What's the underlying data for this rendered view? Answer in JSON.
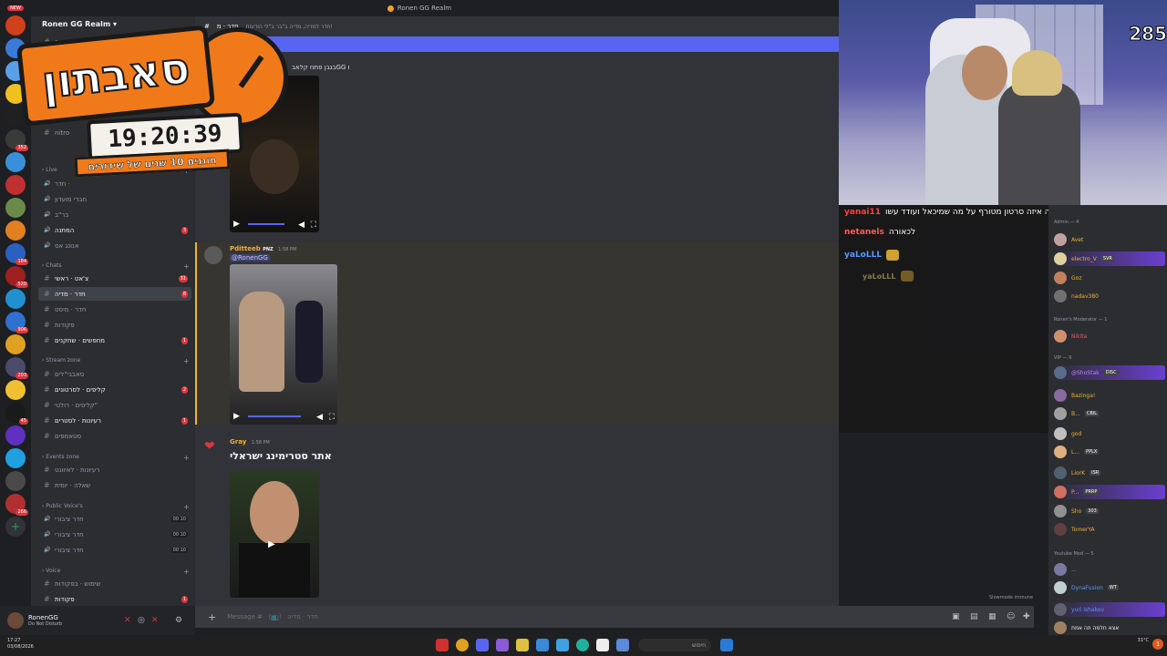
{
  "window": {
    "title": "Ronen GG Realm"
  },
  "server": {
    "name": "Ronen GG Realm"
  },
  "rail": {
    "top_label": "NEW",
    "servers": [
      {
        "color": "#d0401a",
        "badge": ""
      },
      {
        "color": "#3a7ad8",
        "badge": ""
      },
      {
        "color": "#5aa0e8",
        "badge": ""
      },
      {
        "color": "#f0c020",
        "badge": ""
      },
      {
        "color": "#202020",
        "badge": ""
      },
      {
        "color": "#3a3a3a",
        "badge": "352"
      },
      {
        "color": "#3a90d8",
        "badge": ""
      },
      {
        "color": "#c03030",
        "badge": ""
      },
      {
        "color": "#6a8a4a",
        "badge": ""
      },
      {
        "color": "#e08020",
        "badge": ""
      },
      {
        "color": "#2a60c0",
        "badge": "184"
      },
      {
        "color": "#a02020",
        "badge": "520"
      },
      {
        "color": "#2090d0",
        "badge": ""
      },
      {
        "color": "#3070d0",
        "badge": "906"
      },
      {
        "color": "#e0a020",
        "badge": ""
      },
      {
        "color": "#4a4a6a",
        "badge": "203"
      },
      {
        "color": "#f0c030",
        "badge": ""
      },
      {
        "color": "#1a1a1a",
        "badge": "45"
      },
      {
        "color": "#6030c0",
        "badge": ""
      },
      {
        "color": "#20a0e0",
        "badge": ""
      },
      {
        "color": "#4a4a4a",
        "badge": ""
      },
      {
        "color": "#b03030",
        "badge": "266"
      }
    ]
  },
  "channels": {
    "top": [
      {
        "label": "עדכונים",
        "active": false
      },
      {
        "label": "nitro",
        "active": false
      }
    ],
    "live_cat": "Live",
    "live": [
      {
        "label": "חדר · ",
        "count": ""
      },
      {
        "label": "חברי מועדון",
        "count": ""
      },
      {
        "label": "בר\"ב",
        "count": ""
      },
      {
        "label": "המתנה",
        "count": "3"
      },
      {
        "label": "אנונג אס",
        "count": ""
      }
    ],
    "chats_cat": "Chats",
    "chats": [
      {
        "label": "צ'אט · ראשי",
        "count": "31",
        "active": false
      },
      {
        "label": "חדר · מדיה",
        "count": "8",
        "active": true
      },
      {
        "label": "חדר · מיסט",
        "count": "",
        "active": false
      },
      {
        "label": "פקודות",
        "count": "",
        "active": false
      },
      {
        "label": "מחפשים · שחקנים",
        "count": "1",
        "active": false
      }
    ],
    "stream_cat": "Stream zone",
    "stream": [
      {
        "label": "סאבבי\"לים",
        "count": ""
      },
      {
        "label": "קליפים · לסרטונים",
        "count": "2"
      },
      {
        "label": "קליפים · רולטי\"",
        "count": ""
      },
      {
        "label": "רעיונות · לסטרים",
        "count": "1"
      },
      {
        "label": "סטאמפים",
        "count": ""
      }
    ],
    "events_cat": "Events zone",
    "events": [
      {
        "label": "רעיונות · לאיוונט",
        "count": ""
      },
      {
        "label": "שאלה · יומית",
        "count": ""
      }
    ],
    "public_cat": "Public Voice's",
    "public": [
      {
        "label": "חדר ציבורי",
        "voice": "00 10"
      },
      {
        "label": "חדר ציבורי",
        "voice": "00 10"
      },
      {
        "label": "חדר ציבורי",
        "voice": "00 10"
      }
    ],
    "voice_cat": "Voice",
    "voice": [
      {
        "label": "שימוש · בפקודות",
        "count": ""
      },
      {
        "label": "פקודות",
        "count": "1"
      }
    ]
  },
  "user": {
    "name": "RonenGG",
    "status": "Do Not Disturb"
  },
  "chat": {
    "header_name": "חדר · מ",
    "header_topic": "חדר למדיה, מדיה ב\"בר ב\"לי הודעות!",
    "first_text": "בגבן פתח קלאבGG ו",
    "messages": [
      {
        "author": "Pditteeb",
        "badge": "PNZ",
        "time": "1:58 PM",
        "mention": "@RonenGG",
        "color": "#f0b232"
      },
      {
        "author": "Gray",
        "badge": "",
        "time": "1:58 PM",
        "heading": "אתר סטרימינג ישראלי",
        "color": "#f0b232"
      }
    ],
    "composer_placeholder": "Message # 〔📺〕 חדר · מדיה",
    "slowmode": "Slowmode immune"
  },
  "overlay": {
    "title": "סאבתון",
    "timer": "19:20:39",
    "subtitle": "חוגגים 10 שנים של שידורים"
  },
  "webcam": {
    "corner_number": "285"
  },
  "stream_chat": [
    {
      "user": "yanai11",
      "text": "זיוטיוב תראה איזה סרטון מטורף על מה שמיכאל ועודד עשו SVJ אריאל",
      "color": "#ff4040"
    },
    {
      "user": "netanels",
      "text": "לכאורה",
      "color": "#ff5a5a"
    },
    {
      "user": "yaLoLLL",
      "text": "",
      "color": "#5a9aff"
    },
    {
      "user": "yaLoLLL",
      "text": "",
      "color": "#8a7a4a"
    }
  ],
  "members": {
    "admin_cat": "Admin — 4",
    "admins": [
      {
        "name": "Avet",
        "color": "#f0b232",
        "tag": "",
        "boost": false
      },
      {
        "name": "electro_V",
        "color": "#f0b232",
        "tag": "SVR",
        "boost": true
      },
      {
        "name": "Goz",
        "color": "#f0b232",
        "tag": "",
        "boost": false
      },
      {
        "name": "nadav380",
        "color": "#f0b232",
        "tag": "",
        "boost": false
      }
    ],
    "mod_cat": "Ronen's Moderator — 1",
    "mods": [
      {
        "name": "Nikita",
        "color": "#e86060",
        "tag": "",
        "boost": false
      }
    ],
    "vip_cat": "VIP — 9",
    "vips": [
      {
        "name": "@ShoStak",
        "color": "#c080ff",
        "tag": "DISC",
        "boost": true
      },
      {
        "name": "Bazinga!",
        "color": "#f0b232",
        "tag": "",
        "boost": false
      },
      {
        "name": "B...",
        "color": "#f0b232",
        "tag": "CBIL",
        "boost": false
      },
      {
        "name": "god",
        "color": "#f0b232",
        "tag": "",
        "boost": false
      },
      {
        "name": "L...",
        "color": "#f0b232",
        "tag": "PPLX",
        "boost": false
      },
      {
        "name": "LiorK",
        "color": "#f0b232",
        "tag": "ISR",
        "boost": false
      },
      {
        "name": "P...",
        "color": "#f0b232",
        "tag": "PRRP",
        "boost": true
      },
      {
        "name": "Sho",
        "color": "#f0b232",
        "tag": "303",
        "boost": false
      },
      {
        "name": "TomerYA",
        "color": "#f0b232",
        "tag": "",
        "boost": false
      }
    ],
    "yt_cat": "Youtube Mod — 5",
    "yt": [
      {
        "name": "...",
        "color": "#c080ff",
        "tag": "",
        "boost": false
      },
      {
        "name": "DynaFusion",
        "color": "#5a9aff",
        "tag": "WT",
        "boost": false
      },
      {
        "name": "yuri ishakov",
        "color": "#5a9aff",
        "tag": "",
        "boost": true
      },
      {
        "name": "אצא חלמה וזה אמת",
        "color": "#f2f3f5",
        "tag": "",
        "boost": false
      }
    ]
  },
  "taskbar": {
    "time": "17:27",
    "date": "03/08/2026",
    "search": "חיפוש",
    "weather": "31°C",
    "notif": "1"
  }
}
